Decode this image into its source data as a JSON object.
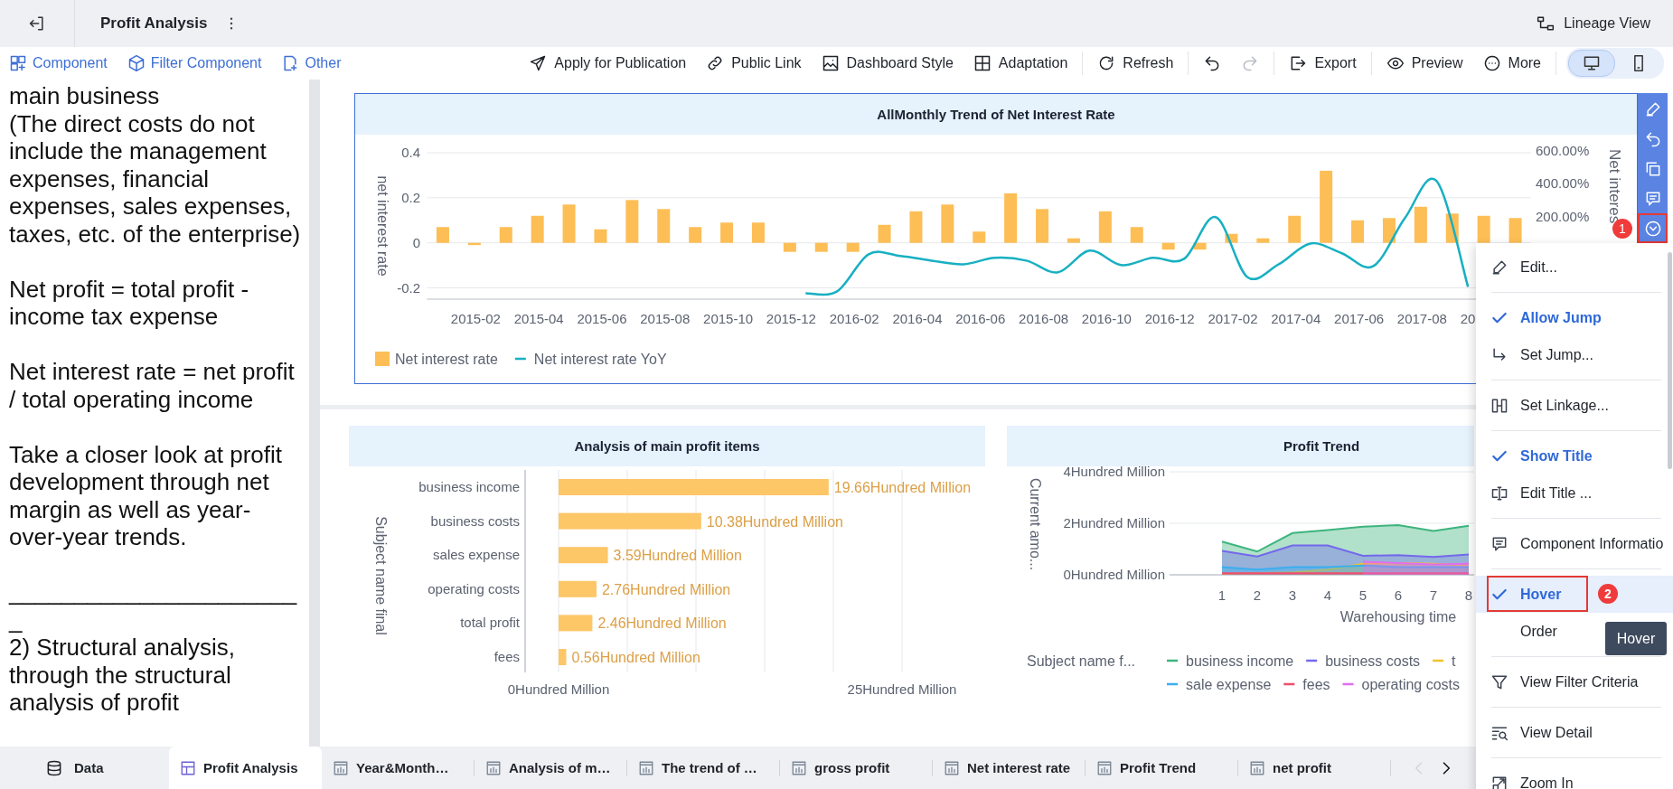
{
  "header": {
    "title": "Profit Analysis",
    "lineage_view": "Lineage View"
  },
  "toolbar": {
    "left": [
      {
        "kind": "component",
        "label": "Component"
      },
      {
        "kind": "cube",
        "label": "Filter Component"
      },
      {
        "kind": "other",
        "label": "Other"
      }
    ],
    "groups": [
      [
        {
          "kind": "publish",
          "label": "Apply for Publication",
          "disabled": false
        },
        {
          "kind": "link",
          "label": "Public Link",
          "disabled": false
        },
        {
          "kind": "style",
          "label": "Dashboard Style",
          "disabled": false
        },
        {
          "kind": "adapt",
          "label": "Adaptation",
          "disabled": false
        }
      ],
      [
        {
          "kind": "refresh",
          "label": "Refresh",
          "disabled": false
        }
      ],
      [
        {
          "kind": "undo",
          "disabled": false
        },
        {
          "kind": "redo",
          "disabled": true
        }
      ],
      [
        {
          "kind": "export",
          "label": "Export",
          "disabled": false
        }
      ],
      [
        {
          "kind": "preview",
          "label": "Preview",
          "disabled": false
        },
        {
          "kind": "more",
          "label": "More",
          "disabled": false
        }
      ]
    ],
    "devices": [
      {
        "kind": "desktop",
        "selected": true
      },
      {
        "kind": "mobile",
        "selected": false
      }
    ]
  },
  "text_panel": {
    "paragraphs": [
      "main business\n(The direct costs do not include the management expenses, financial expenses, sales expenses, taxes, etc. of the enterprise)",
      "Net profit = total profit - income tax expense",
      "Net interest rate = net profit / total operating income",
      "Take a closer look at profit development through net margin as well as year-over-year trends.",
      "_______________________\n2) Structural analysis, through the structural analysis of profit"
    ]
  },
  "trend_card": {
    "selected": true,
    "chart_data": {
      "type": "bar",
      "title": "AllMonthly Trend of Net Interest Rate",
      "ylabel": "net interest rate",
      "grid": true,
      "legend": true,
      "categories": [
        null,
        "2015-02",
        null,
        "2015-04",
        null,
        "2015-06",
        null,
        "2015-08",
        null,
        "2015-10",
        null,
        "2015-12",
        null,
        "2016-02",
        null,
        "2016-04",
        null,
        "2016-06",
        null,
        "2016-08",
        null,
        "2016-10",
        null,
        "2016-12",
        null,
        "2017-02",
        null,
        "2017-04",
        null,
        "2017-06",
        null,
        "2017-08",
        null,
        "20",
        null
      ],
      "ylim": [
        -0.25,
        0.4
      ],
      "yticks": [
        {
          "value": 0.4,
          "label": "0.4"
        },
        {
          "value": 0.2,
          "label": "0.2"
        },
        {
          "value": 0,
          "label": "0"
        },
        {
          "value": -0.2,
          "label": "-0.2"
        }
      ],
      "series": [
        {
          "name": "Net interest rate",
          "color": "#fdbe56",
          "values": [
            0.07,
            -0.01,
            0.07,
            0.12,
            0.17,
            0.06,
            0.19,
            0.15,
            0.07,
            0.09,
            0.09,
            -0.04,
            -0.04,
            -0.04,
            0.08,
            0.14,
            0.17,
            0.05,
            0.22,
            0.15,
            0.02,
            0.14,
            0.07,
            -0.03,
            -0.03,
            0.04,
            0.02,
            0.12,
            0.32,
            0.1,
            0.11,
            0.16,
            0.13,
            0.12,
            0.11
          ]
        }
      ]
    },
    "overlay": {
      "chart_data": {
        "type": "line",
        "ylabel": "Net interes",
        "legend": true,
        "categories": [
          null,
          null,
          null,
          null,
          null,
          null,
          null,
          null,
          null,
          null,
          null,
          null,
          null,
          null,
          null,
          null,
          null,
          null,
          null,
          null,
          null,
          null,
          null,
          null,
          null,
          null,
          null,
          null,
          null,
          null,
          null,
          null,
          null,
          null,
          null
        ],
        "ylim": [
          -300,
          600
        ],
        "yticks": [
          {
            "value": 600,
            "label": "600.00%"
          },
          {
            "value": 400,
            "label": "400.00%"
          },
          {
            "value": 200,
            "label": "200.00%"
          }
        ],
        "series": [
          {
            "name": "Net interest rate YoY",
            "color": "#17b0c2",
            "values": [
              null,
              null,
              null,
              null,
              null,
              null,
              null,
              null,
              null,
              null,
              null,
              null,
              -264,
              -253,
              -27,
              -38,
              -66,
              -88,
              -49,
              -66,
              -137,
              -5,
              -93,
              -49,
              -55,
              198,
              -165,
              -88,
              38,
              -22,
              -99,
              192,
              418,
              -225,
              null
            ]
          }
        ]
      }
    }
  },
  "side_toolbar": {
    "buttons": [
      {
        "kind": "edit"
      },
      {
        "kind": "undo"
      },
      {
        "kind": "copy"
      },
      {
        "kind": "comment"
      },
      {
        "kind": "chevron",
        "annotation": "1"
      }
    ]
  },
  "items_card": {
    "selected": false,
    "chart_data": {
      "type": "bar",
      "orientation": "horizontal",
      "title": "Analysis of main profit items",
      "ylabel": "Subject name final",
      "grid": true,
      "categories": [
        "business income",
        "business costs",
        "sales expense",
        "operating costs",
        "total profit",
        "fees"
      ],
      "values": [
        19.66,
        10.38,
        3.59,
        2.76,
        2.46,
        0.56
      ],
      "xlim": [
        0,
        25
      ],
      "xticks": [
        {
          "value": 0,
          "label": "0Hundred Million"
        },
        {
          "value": 25,
          "label": "25Hundred Million"
        }
      ],
      "value_labels": [
        "19.66Hundred Million",
        "10.38Hundred Million",
        "3.59Hundred Million",
        "2.76Hundred Million",
        "2.46Hundred Million",
        "0.56Hundred Million"
      ]
    }
  },
  "profit_card": {
    "selected": false,
    "chart_data": {
      "type": "area",
      "title": "Profit Trend",
      "xlabel": "Warehousing time",
      "ylabel": "Current amo...",
      "grid": true,
      "legend": {
        "title": "Subject name f..."
      },
      "categories": [
        "1",
        "2",
        "3",
        "4",
        "5",
        "6",
        "7",
        "8"
      ],
      "ylim": [
        0,
        4
      ],
      "yticks": [
        {
          "value": 4,
          "label": "4Hundred Million"
        },
        {
          "value": 2,
          "label": "2Hundred Million"
        },
        {
          "value": 0,
          "label": "0Hundred Million"
        }
      ],
      "stacked": false,
      "series": [
        {
          "name": "business income",
          "color": "#3db47e",
          "values": [
            1.29,
            0.9,
            1.62,
            1.74,
            1.87,
            1.93,
            1.7,
            1.9
          ]
        },
        {
          "name": "business costs",
          "color": "#7468ec",
          "values": [
            0.93,
            0.71,
            1.14,
            1.14,
            0.74,
            0.76,
            0.69,
            0.79
          ]
        },
        {
          "name": "t",
          "color": "#f3c22a",
          "values": [
            0.03,
            0.06,
            0.1,
            0.2,
            0.43,
            0.46,
            0.43,
            0.38
          ]
        },
        {
          "name": "sale expense",
          "color": "#3aaef0",
          "values": [
            0.3,
            0.2,
            0.3,
            0.3,
            0.36,
            0.3,
            0.3,
            0.3
          ]
        },
        {
          "name": "fees",
          "color": "#f04d6e",
          "values": [
            0.06,
            0.06,
            0.06,
            0.06,
            0.06,
            0.06,
            0.06,
            0.06
          ]
        },
        {
          "name": "operating costs",
          "color": "#de6ff0",
          "values": [
            null,
            null,
            null,
            null,
            0.51,
            0.46,
            0.4,
            0.43
          ]
        }
      ]
    }
  },
  "menu": {
    "groups": [
      [
        {
          "kind": "edit",
          "label": "Edit...",
          "highlighted": false
        }
      ],
      [
        {
          "kind": "check",
          "label": "Allow Jump",
          "checked": true,
          "highlighted": false
        },
        {
          "kind": "jump",
          "label": "Set Jump...",
          "highlighted": false
        }
      ],
      [
        {
          "kind": "linkage",
          "label": "Set Linkage...",
          "highlighted": false
        }
      ],
      [
        {
          "kind": "check",
          "label": "Show Title",
          "checked": true,
          "highlighted": false
        },
        {
          "kind": "title",
          "label": "Edit Title ...",
          "highlighted": false
        }
      ],
      [
        {
          "kind": "info",
          "label": "Component Informatio",
          "highlighted": false
        }
      ],
      [
        {
          "kind": "check",
          "label": "Hover",
          "checked": true,
          "highlighted": true,
          "annotation": "2"
        },
        {
          "kind": "check",
          "label": "Order",
          "checked": false,
          "highlighted": false
        }
      ],
      [
        {
          "kind": "filter",
          "label": "View Filter Criteria",
          "highlighted": false
        }
      ],
      [
        {
          "kind": "detail",
          "label": "View Detail",
          "highlighted": false
        }
      ],
      [
        {
          "kind": "zoom",
          "label": "Zoom In",
          "highlighted": false
        }
      ]
    ],
    "tooltip": "Hover"
  },
  "sheet_bar": {
    "data": "Data",
    "tabs": [
      {
        "kind": "dashboard",
        "label": "Profit Analysis",
        "selected": true
      },
      {
        "kind": "chart",
        "label": "Year&Month…",
        "selected": false
      },
      {
        "kind": "chart",
        "label": "Analysis of m…",
        "selected": false
      },
      {
        "kind": "chart",
        "label": "The trend of …",
        "selected": false
      },
      {
        "kind": "chart",
        "label": "gross profit",
        "selected": false
      },
      {
        "kind": "chart",
        "label": "Net interest rate",
        "selected": false
      },
      {
        "kind": "chart",
        "label": "Profit Trend",
        "selected": false
      },
      {
        "kind": "chart",
        "label": "net profit",
        "selected": false
      }
    ],
    "pager": [
      {
        "kind": "prev",
        "disabled": true
      },
      {
        "kind": "next",
        "disabled": false
      }
    ]
  }
}
